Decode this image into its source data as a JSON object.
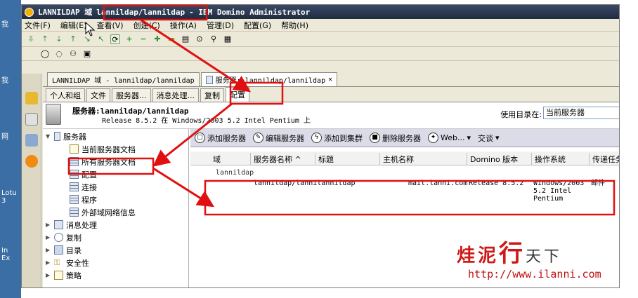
{
  "desktop": {
    "labels": [
      "我",
      "我",
      "网",
      "Lotu\n3",
      "In\nEx"
    ]
  },
  "window": {
    "title_prefix": "LANNILDAP 域",
    "title_server": "lannildap/lannildap",
    "title_suffix": "- IBM Domino Administrator"
  },
  "menu": [
    "文件(F)",
    "编辑(E)",
    "查看(V)",
    "创建(C)",
    "操作(A)",
    "管理(D)",
    "配置(G)",
    "帮助(H)"
  ],
  "document_tabs": [
    {
      "label": "LANNILDAP 域 - lannildap/lannildap"
    },
    {
      "label": "服务器: lannildap/lannildap",
      "close": "✕"
    }
  ],
  "inner_tabs": [
    "个人和组",
    "文件",
    "服务器...",
    "消息处理...",
    "复制",
    "配置"
  ],
  "server_header": {
    "name": "服务器:lannildap/lannildap",
    "release": "Release 8.5.2 在 Windows/2003 5.2 Intel Pentium 上",
    "directory_label": "使用目录在:",
    "directory_value": "当前服务器"
  },
  "tree": {
    "root": "服务器",
    "children": [
      "当前服务器文档",
      "所有服务器文档",
      "配置",
      "连接",
      "程序",
      "外部域网络信息"
    ],
    "others": [
      "消息处理",
      "复制",
      "目录",
      "安全性",
      "策略"
    ]
  },
  "actions": [
    "添加服务器",
    "编辑服务器",
    "添加到集群",
    "删除服务器",
    "Web...",
    "交谈"
  ],
  "columns": [
    "域",
    "服务器名称 ^",
    "标题",
    "主机名称",
    "Domino 版本",
    "操作系统",
    "传递任务"
  ],
  "category": "lannildap",
  "row": {
    "server_name": "lannildap/lannilannildap",
    "host": "mail.lanni.com",
    "version": "Release 8.5.2",
    "os": "Windows/2003\n5.2 Intel\nPentium",
    "task": "邮件"
  },
  "watermark": {
    "text_a": "烓泥",
    "text_big": "行",
    "text_b": "天下",
    "url": "http://www.ilanni.com"
  },
  "colors": {
    "highlight": "#e01010",
    "titlebar": "#1f2b3f",
    "actionbar": "#dcdce8"
  }
}
